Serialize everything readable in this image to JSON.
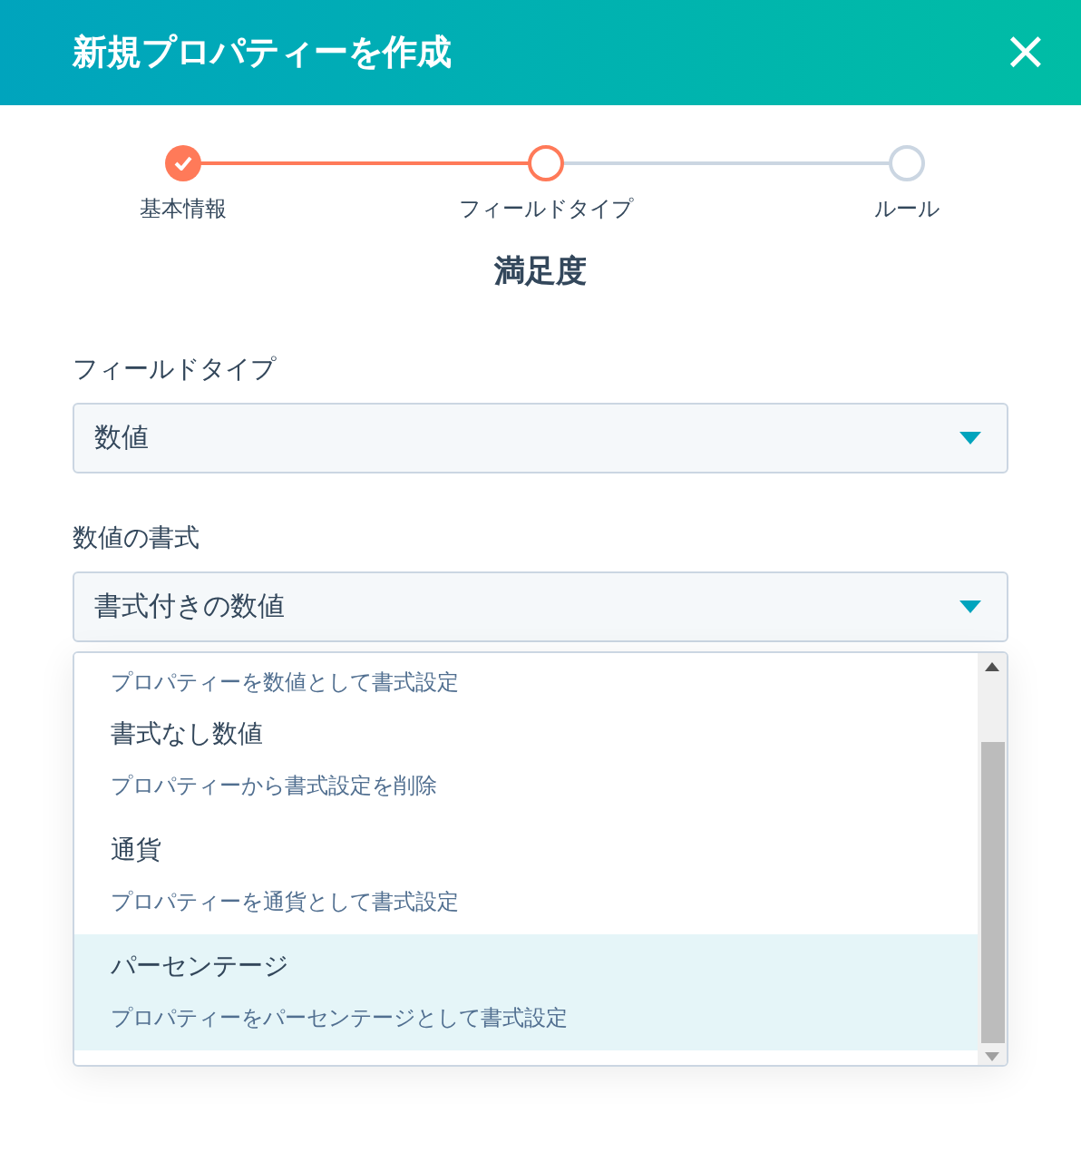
{
  "dialog": {
    "title": "新規プロパティーを作成",
    "close": "×"
  },
  "steps": [
    {
      "label": "基本情報",
      "kind": "done"
    },
    {
      "label": "フィールドタイプ",
      "kind": "current"
    },
    {
      "label": "ルール",
      "kind": "todo"
    }
  ],
  "property_name": "満足度",
  "fields": [
    {
      "label": "フィールドタイプ",
      "value": "数値"
    },
    {
      "label": "数値の書式",
      "value": "書式付きの数値"
    }
  ],
  "dropdown": {
    "options": [
      {
        "description": "プロパティーを数値として書式設定",
        "selected": false
      },
      {
        "title": "書式なし数値",
        "description": "プロパティーから書式設定を削除",
        "selected": false
      },
      {
        "title": "通貨",
        "description": "プロパティーを通貨として書式設定",
        "selected": false
      },
      {
        "title": "パーセンテージ",
        "description": "プロパティーをパーセンテージとして書式設定",
        "selected": true
      }
    ]
  }
}
